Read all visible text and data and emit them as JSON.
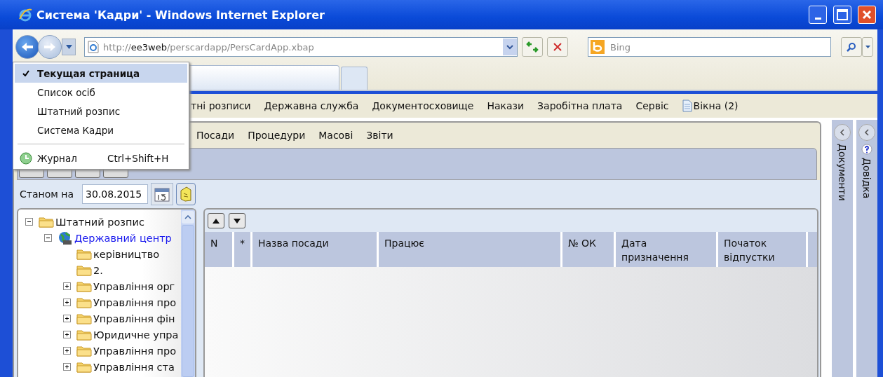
{
  "window": {
    "title": "Система 'Кадри' - Windows Internet Explorer"
  },
  "address_bar": {
    "scheme": "http://",
    "host": "ee3web",
    "path": "/perscardapp/PersCardApp.xbap"
  },
  "search": {
    "placeholder": "Bing"
  },
  "history_menu": {
    "items": [
      {
        "label": "Текущая страница",
        "selected": true
      },
      {
        "label": "Список осіб",
        "selected": false
      },
      {
        "label": "Штатний розпис",
        "selected": false
      },
      {
        "label": "Система Кадри",
        "selected": false
      }
    ],
    "journal": {
      "label": "Журнал",
      "shortcut": "Ctrl+Shift+H"
    }
  },
  "menu_bar": [
    {
      "label": "тні розписи",
      "kind": "menu"
    },
    {
      "label": "Державна служба",
      "kind": "menu"
    },
    {
      "label": "Документосховище",
      "kind": "menu"
    },
    {
      "label": "Накази",
      "kind": "menu"
    },
    {
      "label": "Заробітна плата",
      "kind": "menu"
    },
    {
      "label": "Сервіс",
      "kind": "menu"
    },
    {
      "label": "Вікна (2)",
      "kind": "windows"
    }
  ],
  "submenu": [
    "Посади",
    "Процедури",
    "Масові",
    "Звіти"
  ],
  "date_filter": {
    "label": "Станом на",
    "value": "30.08.2015"
  },
  "tree": {
    "label": "Штатний розпис",
    "kind": "folder",
    "expanded": true,
    "children": [
      {
        "label": "Державний центр",
        "kind": "org",
        "expanded": true,
        "children": [
          {
            "label": "керівництво",
            "kind": "folder"
          },
          {
            "label": "2.",
            "kind": "folder"
          },
          {
            "label": "Управління орг",
            "kind": "folder",
            "expanded": false
          },
          {
            "label": "Управління про",
            "kind": "folder",
            "expanded": false
          },
          {
            "label": "Управління фін",
            "kind": "folder",
            "expanded": false
          },
          {
            "label": "Юридичне упра",
            "kind": "folder",
            "expanded": false
          },
          {
            "label": "Управління про",
            "kind": "folder",
            "expanded": false
          },
          {
            "label": "Управління ста",
            "kind": "folder",
            "expanded": false
          }
        ]
      }
    ]
  },
  "grid": {
    "columns": [
      "N",
      "*",
      "Назва посади",
      "Працює",
      "№ ОК",
      "Дата призначення",
      "Початок відпустки"
    ]
  },
  "side_panels": [
    "Документи",
    "Довідка"
  ]
}
